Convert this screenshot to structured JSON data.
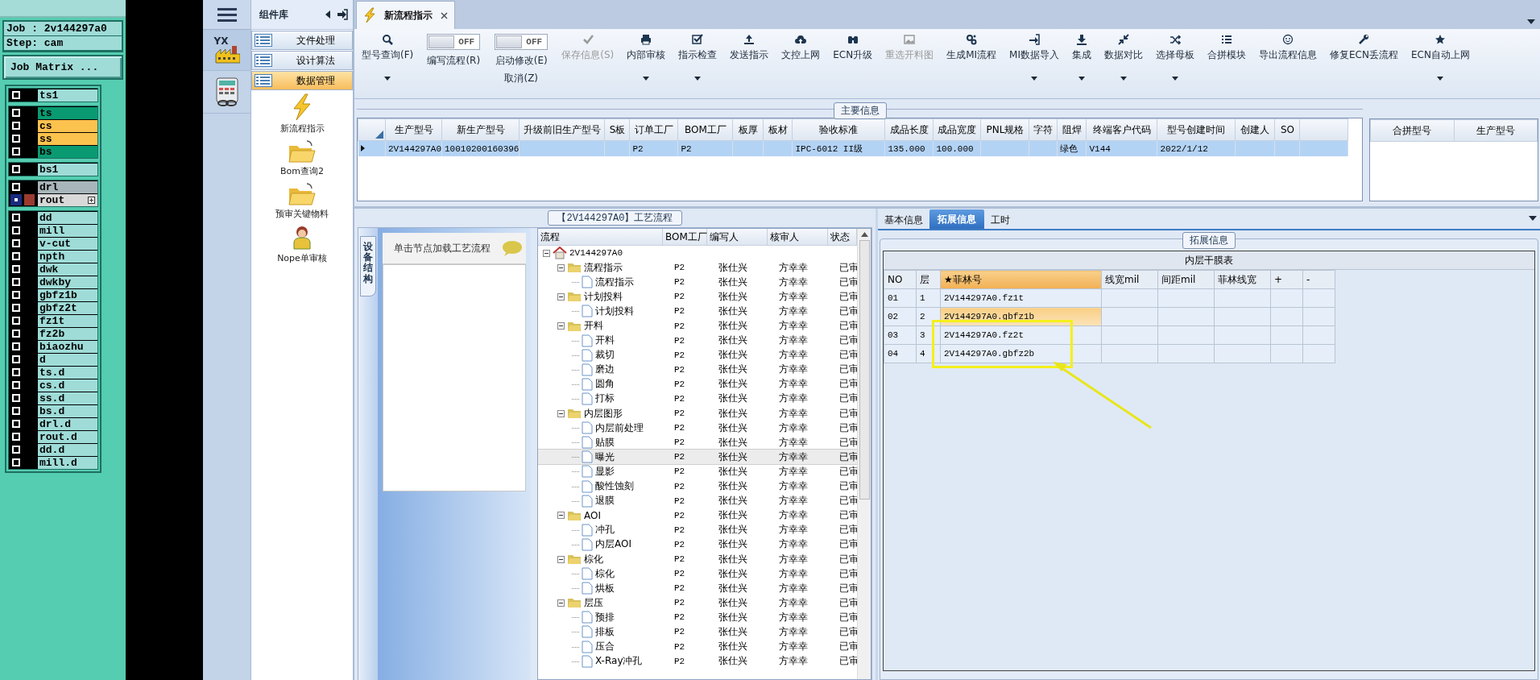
{
  "cam": {
    "job": "Job : 2v144297a0",
    "step": "Step: cam",
    "matrix_button": "Job Matrix ...",
    "groups": [
      [
        {
          "name": "ts1",
          "color": "#9fdcd8",
          "selected": false
        }
      ],
      [
        {
          "name": "ts",
          "color": "#0a9a72",
          "selected": false
        },
        {
          "name": "cs",
          "color": "#fbc24e",
          "selected": false
        },
        {
          "name": "ss",
          "color": "#fbc24e",
          "selected": false
        },
        {
          "name": "bs",
          "color": "#0a9a72",
          "selected": false
        }
      ],
      [
        {
          "name": "bs1",
          "color": "#9fdcd8",
          "selected": false
        }
      ],
      [
        {
          "name": "drl",
          "color": "#a8b5ba",
          "selected": false
        },
        {
          "name": "rout",
          "color": "#d9d9d9",
          "selected": true
        }
      ],
      [
        {
          "name": "dd",
          "color": "#9fdcd8",
          "selected": false
        },
        {
          "name": "mill",
          "color": "#9fdcd8",
          "selected": false
        },
        {
          "name": "v-cut",
          "color": "#9fdcd8",
          "selected": false
        },
        {
          "name": "npth",
          "color": "#9fdcd8",
          "selected": false
        },
        {
          "name": "dwk",
          "color": "#9fdcd8",
          "selected": false
        },
        {
          "name": "dwkby",
          "color": "#9fdcd8",
          "selected": false
        },
        {
          "name": "gbfz1b",
          "color": "#9fdcd8",
          "selected": false
        },
        {
          "name": "gbfz2t",
          "color": "#9fdcd8",
          "selected": false
        },
        {
          "name": "fz1t",
          "color": "#9fdcd8",
          "selected": false
        },
        {
          "name": "fz2b",
          "color": "#9fdcd8",
          "selected": false
        },
        {
          "name": "biaozhu",
          "color": "#9fdcd8",
          "selected": false
        },
        {
          "name": "d",
          "color": "#9fdcd8",
          "selected": false
        },
        {
          "name": "ts.d",
          "color": "#9fdcd8",
          "selected": false
        },
        {
          "name": "cs.d",
          "color": "#9fdcd8",
          "selected": false
        },
        {
          "name": "ss.d",
          "color": "#9fdcd8",
          "selected": false
        },
        {
          "name": "bs.d",
          "color": "#9fdcd8",
          "selected": false
        },
        {
          "name": "drl.d",
          "color": "#9fdcd8",
          "selected": false
        },
        {
          "name": "rout.d",
          "color": "#9fdcd8",
          "selected": false
        },
        {
          "name": "dd.d",
          "color": "#9fdcd8",
          "selected": false
        },
        {
          "name": "mill.d",
          "color": "#9fdcd8",
          "selected": false
        }
      ]
    ]
  },
  "rail": {
    "logo_text": "YX"
  },
  "library": {
    "title": "组件库",
    "categories": [
      {
        "label": "文件处理",
        "selected": false
      },
      {
        "label": "设计算法",
        "selected": false
      },
      {
        "label": "数据管理",
        "selected": true
      }
    ],
    "tools": [
      {
        "label": "新流程指示",
        "kind": "lightning"
      },
      {
        "label": "Bom查询2",
        "kind": "folder"
      },
      {
        "label": "预审关键物料",
        "kind": "folder"
      },
      {
        "label": "Nope单审核",
        "kind": "person"
      }
    ]
  },
  "doc_tabs": [
    {
      "label": "新流程指示",
      "selected": true
    }
  ],
  "toolbar": [
    {
      "kind": "button",
      "label": "型号查询(F)",
      "dropdown": true,
      "disabled": false
    },
    {
      "kind": "toggle",
      "label": "编写流程(R)",
      "state": "OFF",
      "on": false
    },
    {
      "kind": "toggle",
      "label": "启动修改(E)",
      "sublabel": "取消(Z)",
      "state": "OFF",
      "on": false
    },
    {
      "kind": "button",
      "label": "保存信息(S)",
      "dropdown": false,
      "disabled": true
    },
    {
      "kind": "button",
      "label": "内部审核",
      "dropdown": true,
      "disabled": false
    },
    {
      "kind": "button",
      "label": "指示检查",
      "dropdown": true,
      "disabled": false
    },
    {
      "kind": "button",
      "label": "发送指示",
      "dropdown": false,
      "disabled": false
    },
    {
      "kind": "button",
      "label": "文控上网",
      "dropdown": false,
      "disabled": false
    },
    {
      "kind": "button",
      "label": "ECN升级",
      "dropdown": false,
      "disabled": false
    },
    {
      "kind": "button",
      "label": "重选开料图",
      "dropdown": false,
      "disabled": true
    },
    {
      "kind": "button",
      "label": "生成MI流程",
      "dropdown": false,
      "disabled": false
    },
    {
      "kind": "button",
      "label": "MI数据导入",
      "dropdown": true,
      "disabled": false
    },
    {
      "kind": "button",
      "label": "集成",
      "dropdown": true,
      "disabled": false
    },
    {
      "kind": "button",
      "label": "数据对比",
      "dropdown": true,
      "disabled": false
    },
    {
      "kind": "button",
      "label": "选择母板",
      "dropdown": true,
      "disabled": false
    },
    {
      "kind": "button",
      "label": "合拼模块",
      "dropdown": false,
      "disabled": false
    },
    {
      "kind": "button",
      "label": "导出流程信息",
      "dropdown": false,
      "disabled": false
    },
    {
      "kind": "button",
      "label": "修复ECN丢流程",
      "dropdown": false,
      "disabled": false
    },
    {
      "kind": "button",
      "label": "ECN自动上网",
      "dropdown": true,
      "disabled": false
    }
  ],
  "main_info": {
    "title": "主要信息",
    "columns": [
      "生产型号",
      "新生产型号",
      "升级前旧生产型号",
      "S板",
      "订单工厂",
      "BOM工厂",
      "板厚",
      "板材",
      "验收标准",
      "成品长度",
      "成品宽度",
      "PNL规格",
      "字符",
      "阻焊",
      "终端客户代码",
      "型号创建时间",
      "创建人",
      "SO"
    ],
    "rows": [
      {
        "selected": true,
        "cells": [
          "2V144297A0",
          "10010200160396",
          null,
          null,
          "P2",
          "P2",
          null,
          null,
          "IPC-6012 II级",
          "135.000",
          "100.000",
          null,
          null,
          "绿色",
          "V144",
          "2022/1/12",
          null,
          null
        ]
      }
    ],
    "side_columns": [
      "合拼型号",
      "生产型号"
    ]
  },
  "flow": {
    "title": "【2V144297A0】工艺流程",
    "side_tab": "设备结构",
    "hint": "单击节点加载工艺流程",
    "columns": [
      "流程",
      "BOM工厂",
      "编写人",
      "核审人",
      "状态"
    ],
    "tree": {
      "label": "2V144297A0",
      "expanded": true,
      "selected": false,
      "children": [
        {
          "label": "流程指示",
          "cells": [
            "P2",
            "张仕兴",
            "方幸幸",
            "已审"
          ],
          "expanded": true,
          "selected": false,
          "children": [
            {
              "label": "流程指示",
              "cells": [
                "P2",
                "张仕兴",
                "方幸幸",
                "已审"
              ],
              "selected": false
            }
          ]
        },
        {
          "label": "计划投料",
          "cells": [
            "P2",
            "张仕兴",
            "方幸幸",
            "已审"
          ],
          "expanded": true,
          "selected": false,
          "children": [
            {
              "label": "计划投料",
              "cells": [
                "P2",
                "张仕兴",
                "方幸幸",
                "已审"
              ],
              "selected": false
            }
          ]
        },
        {
          "label": "开料",
          "cells": [
            "P2",
            "张仕兴",
            "方幸幸",
            "已审"
          ],
          "expanded": true,
          "selected": false,
          "children": [
            {
              "label": "开料",
              "cells": [
                "P2",
                "张仕兴",
                "方幸幸",
                "已审"
              ],
              "selected": false
            },
            {
              "label": "裁切",
              "cells": [
                "P2",
                "张仕兴",
                "方幸幸",
                "已审"
              ],
              "selected": false
            },
            {
              "label": "磨边",
              "cells": [
                "P2",
                "张仕兴",
                "方幸幸",
                "已审"
              ],
              "selected": false
            },
            {
              "label": "圆角",
              "cells": [
                "P2",
                "张仕兴",
                "方幸幸",
                "已审"
              ],
              "selected": false
            },
            {
              "label": "打标",
              "cells": [
                "P2",
                "张仕兴",
                "方幸幸",
                "已审"
              ],
              "selected": false
            }
          ]
        },
        {
          "label": "内层图形",
          "cells": [
            "P2",
            "张仕兴",
            "方幸幸",
            "已审"
          ],
          "expanded": true,
          "selected": false,
          "children": [
            {
              "label": "内层前处理",
              "cells": [
                "P2",
                "张仕兴",
                "方幸幸",
                "已审"
              ],
              "selected": false
            },
            {
              "label": "贴膜",
              "cells": [
                "P2",
                "张仕兴",
                "方幸幸",
                "已审"
              ],
              "selected": false
            },
            {
              "label": "曝光",
              "cells": [
                "P2",
                "张仕兴",
                "方幸幸",
                "已审"
              ],
              "selected": true
            },
            {
              "label": "显影",
              "cells": [
                "P2",
                "张仕兴",
                "方幸幸",
                "已审"
              ],
              "selected": false
            },
            {
              "label": "酸性蚀刻",
              "cells": [
                "P2",
                "张仕兴",
                "方幸幸",
                "已审"
              ],
              "selected": false
            },
            {
              "label": "退膜",
              "cells": [
                "P2",
                "张仕兴",
                "方幸幸",
                "已审"
              ],
              "selected": false
            }
          ]
        },
        {
          "label": "AOI",
          "cells": [
            "P2",
            "张仕兴",
            "方幸幸",
            "已审"
          ],
          "expanded": true,
          "selected": false,
          "children": [
            {
              "label": "冲孔",
              "cells": [
                "P2",
                "张仕兴",
                "方幸幸",
                "已审"
              ],
              "selected": false
            },
            {
              "label": "内层AOI",
              "cells": [
                "P2",
                "张仕兴",
                "方幸幸",
                "已审"
              ],
              "selected": false
            }
          ]
        },
        {
          "label": "棕化",
          "cells": [
            "P2",
            "张仕兴",
            "方幸幸",
            "已审"
          ],
          "expanded": true,
          "selected": false,
          "children": [
            {
              "label": "棕化",
              "cells": [
                "P2",
                "张仕兴",
                "方幸幸",
                "已审"
              ],
              "selected": false
            },
            {
              "label": "烘板",
              "cells": [
                "P2",
                "张仕兴",
                "方幸幸",
                "已审"
              ],
              "selected": false
            }
          ]
        },
        {
          "label": "层压",
          "cells": [
            "P2",
            "张仕兴",
            "方幸幸",
            "已审"
          ],
          "expanded": true,
          "selected": false,
          "children": [
            {
              "label": "预排",
              "cells": [
                "P2",
                "张仕兴",
                "方幸幸",
                "已审"
              ],
              "selected": false
            },
            {
              "label": "排板",
              "cells": [
                "P2",
                "张仕兴",
                "方幸幸",
                "已审"
              ],
              "selected": false
            },
            {
              "label": "压合",
              "cells": [
                "P2",
                "张仕兴",
                "方幸幸",
                "已审"
              ],
              "selected": false
            },
            {
              "label": "X-Ray冲孔",
              "cells": [
                "P2",
                "张仕兴",
                "方幸幸",
                "已审"
              ],
              "selected": false
            }
          ]
        }
      ]
    }
  },
  "extension": {
    "tabs": [
      {
        "label": "基本信息",
        "selected": false
      },
      {
        "label": "拓展信息",
        "selected": true
      },
      {
        "label": "工时",
        "selected": false
      }
    ],
    "group_title": "拓展信息",
    "table": {
      "caption": "内层干膜表",
      "columns": [
        {
          "label": "NO",
          "selected": false
        },
        {
          "label": "层",
          "selected": false
        },
        {
          "label": "★菲林号",
          "selected": true
        },
        {
          "label": "线宽mil",
          "selected": false
        },
        {
          "label": "间距mil",
          "selected": false
        },
        {
          "label": "菲林线宽",
          "selected": false
        },
        {
          "label": "+",
          "selected": false
        },
        {
          "label": "-",
          "selected": false
        }
      ],
      "rows": [
        {
          "cells": [
            "01",
            "1",
            "2V144297A0.fz1t"
          ],
          "selected": false
        },
        {
          "cells": [
            "02",
            "2",
            "2V144297A0.gbfz1b"
          ],
          "selected": true
        },
        {
          "cells": [
            "03",
            "3",
            "2V144297A0.fz2t"
          ],
          "selected": false
        },
        {
          "cells": [
            "04",
            "4",
            "2V144297A0.gbfz2b"
          ],
          "selected": false
        }
      ]
    }
  }
}
